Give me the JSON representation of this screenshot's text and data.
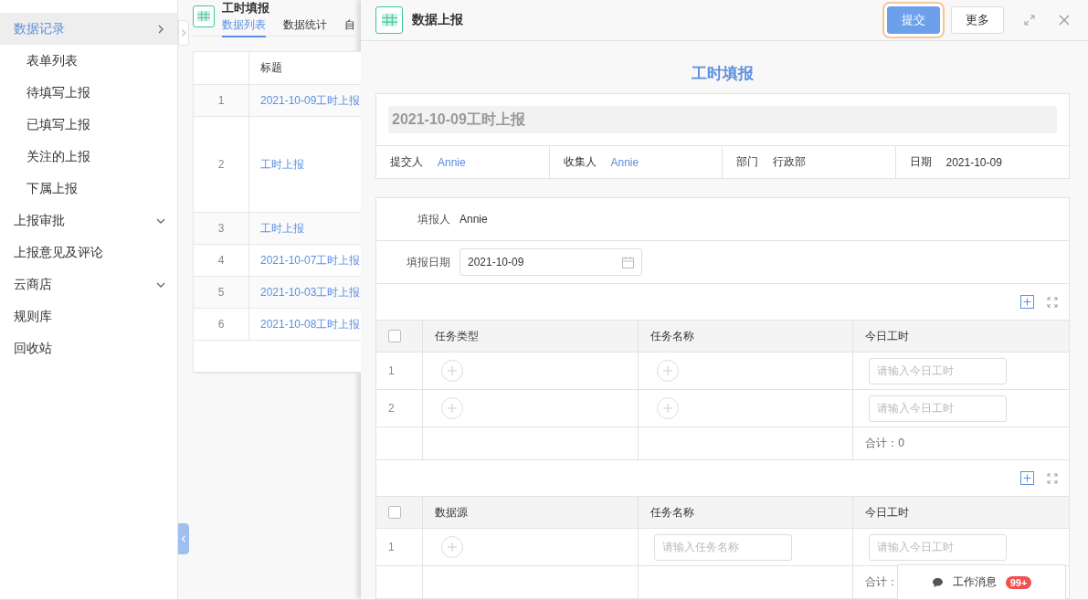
{
  "sidebar": {
    "items": [
      {
        "label": "数据记录",
        "selected": true,
        "kind": "arrow_right",
        "children": [
          {
            "label": "表单列表",
            "selected": false
          },
          {
            "label": "待填写上报",
            "selected": false
          },
          {
            "label": "已填写上报",
            "selected": false
          },
          {
            "label": "关注的上报",
            "selected": false
          },
          {
            "label": "下属上报",
            "selected": false
          }
        ]
      },
      {
        "label": "上报审批",
        "selected": false,
        "kind": "arrow_down"
      },
      {
        "label": "上报意见及评论",
        "selected": false,
        "kind": "plain"
      },
      {
        "label": "云商店",
        "selected": false,
        "kind": "arrow_down"
      },
      {
        "label": "规则库",
        "selected": false,
        "kind": "plain"
      },
      {
        "label": "回收站",
        "selected": false,
        "kind": "plain"
      }
    ]
  },
  "list_panel": {
    "title": "工时填报",
    "tabs": [
      {
        "label": "数据列表",
        "selected": true
      },
      {
        "label": "数据统计",
        "selected": false
      },
      {
        "label": "自",
        "selected": false
      }
    ],
    "table": {
      "columns": [
        "标题"
      ],
      "rows": [
        {
          "index": "1",
          "title": "2021-10-09工时上报",
          "kind": "normal"
        },
        {
          "index": "2",
          "title": "工时上报",
          "kind": "tall"
        },
        {
          "index": "3",
          "title": "工时上报",
          "kind": "normal"
        },
        {
          "index": "4",
          "title": "2021-10-07工时上报",
          "kind": "normal"
        },
        {
          "index": "5",
          "title": "2021-10-03工时上报",
          "kind": "normal"
        },
        {
          "index": "6",
          "title": "2021-10-08工时上报",
          "kind": "normal"
        }
      ]
    }
  },
  "drawer": {
    "title": "数据上报",
    "buttons": [
      {
        "label": "提交",
        "kind": "primary"
      },
      {
        "label": "更多",
        "kind": "default"
      }
    ],
    "form_title": "工时填报",
    "report_title": "2021-10-09工时上报",
    "meta": [
      {
        "label": "提交人",
        "value": "Annie",
        "link": true
      },
      {
        "label": "收集人",
        "value": "Annie",
        "link": true
      },
      {
        "label": "部门",
        "value": "行政部",
        "link": false
      },
      {
        "label": "日期",
        "value": "2021-10-09",
        "link": false
      }
    ],
    "fields": [
      {
        "label": "填报人",
        "value": "Annie",
        "kind": "text"
      },
      {
        "label": "填报日期",
        "value": "2021-10-09",
        "kind": "date"
      }
    ],
    "subtables": [
      {
        "columns": [
          "任务类型",
          "任务名称",
          "今日工时"
        ],
        "checked": false,
        "rows": [
          {
            "index": "1",
            "cells": [
              {
                "kind": "add"
              },
              {
                "kind": "add"
              },
              {
                "kind": "input",
                "placeholder": "请输入今日工时"
              }
            ]
          },
          {
            "index": "2",
            "cells": [
              {
                "kind": "add"
              },
              {
                "kind": "add"
              },
              {
                "kind": "input",
                "placeholder": "请输入今日工时"
              }
            ]
          }
        ],
        "total": "合计：0"
      },
      {
        "columns": [
          "数据源",
          "任务名称",
          "今日工时"
        ],
        "checked": false,
        "rows": [
          {
            "index": "1",
            "cells": [
              {
                "kind": "add"
              },
              {
                "kind": "input",
                "placeholder": "请输入任务名称"
              },
              {
                "kind": "input",
                "placeholder": "请输入今日工时"
              }
            ]
          }
        ],
        "total": "合计："
      }
    ]
  },
  "message_popup": {
    "label": "工作消息",
    "badge": "99+"
  }
}
